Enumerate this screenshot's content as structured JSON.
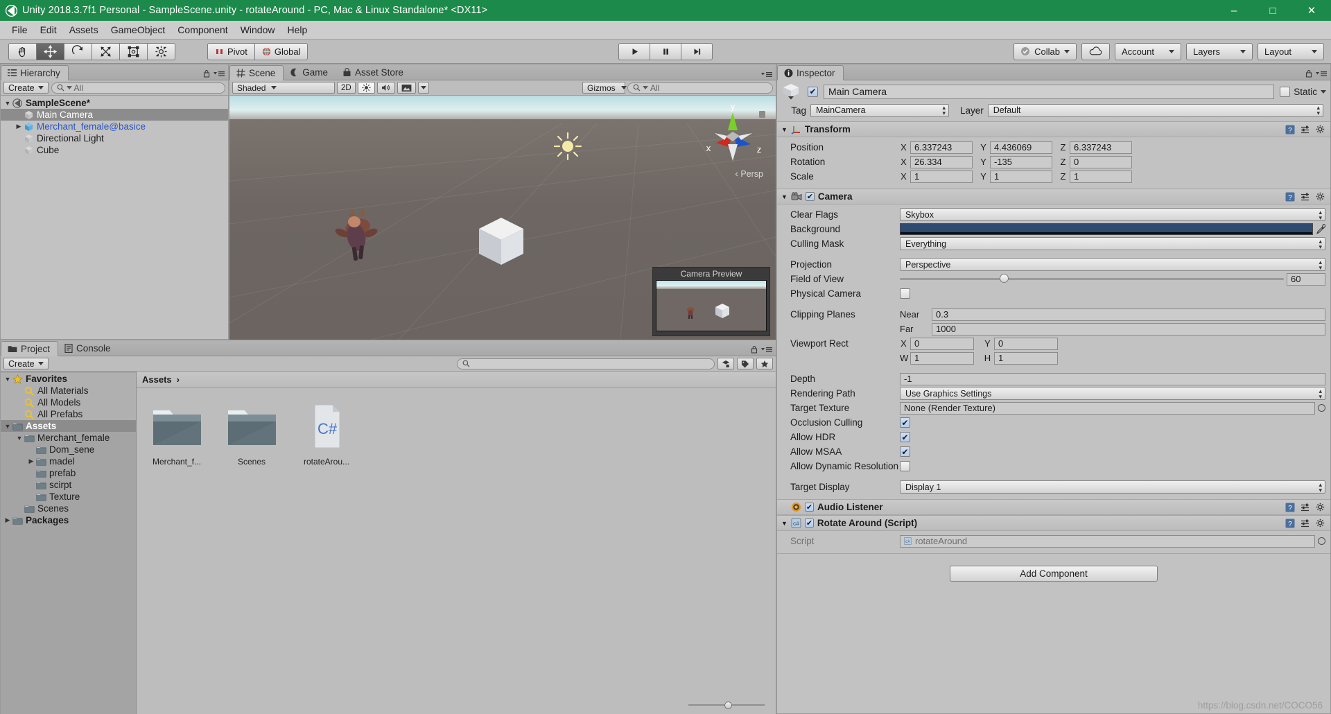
{
  "window": {
    "title": "Unity 2018.3.7f1 Personal - SampleScene.unity - rotateAround - PC, Mac & Linux Standalone* <DX11>",
    "minimize": "–",
    "maximize": "□",
    "close": "✕"
  },
  "menu": {
    "items": [
      "File",
      "Edit",
      "Assets",
      "GameObject",
      "Component",
      "Window",
      "Help"
    ]
  },
  "toolbar": {
    "tools": [
      {
        "name": "hand-tool",
        "active": false
      },
      {
        "name": "move-tool",
        "active": true
      },
      {
        "name": "rotate-tool",
        "active": false
      },
      {
        "name": "scale-tool",
        "active": false
      },
      {
        "name": "rect-tool",
        "active": false
      },
      {
        "name": "transform-tool",
        "active": false
      }
    ],
    "pivot_label": "Pivot",
    "global_label": "Global",
    "play_label": "▶",
    "pause_label": "❚❚",
    "step_label": "▶❘",
    "collab_label": "Collab",
    "account_label": "Account",
    "layers_label": "Layers",
    "layout_label": "Layout"
  },
  "hierarchy": {
    "tab": "Hierarchy",
    "create_label": "Create",
    "search_placeholder": "All",
    "items": [
      {
        "label": "SampleScene*",
        "indent": 0,
        "arrow": "▼",
        "icon": "scene-icon",
        "style": "bold",
        "selected": false
      },
      {
        "label": "Main Camera",
        "indent": 1,
        "arrow": "",
        "icon": "gameobject-icon",
        "style": "normal",
        "selected": true
      },
      {
        "label": "Merchant_female@basice",
        "indent": 1,
        "arrow": "▶",
        "icon": "prefab-icon",
        "style": "blue",
        "selected": false
      },
      {
        "label": "Directional Light",
        "indent": 1,
        "arrow": "",
        "icon": "gameobject-icon",
        "style": "normal",
        "selected": false
      },
      {
        "label": "Cube",
        "indent": 1,
        "arrow": "",
        "icon": "gameobject-icon",
        "style": "normal",
        "selected": false
      }
    ]
  },
  "scene": {
    "tabs": [
      {
        "label": "Scene",
        "icon": "scene-grid-icon",
        "active": true
      },
      {
        "label": "Game",
        "icon": "game-icon",
        "active": false
      },
      {
        "label": "Asset Store",
        "icon": "store-icon",
        "active": false
      }
    ],
    "shading_mode": "Shaded",
    "mode_2d": "2D",
    "gizmos_label": "Gizmos",
    "search_placeholder": "All",
    "axis_x": "x",
    "axis_y": "y",
    "axis_z": "z",
    "persp_label": "Persp",
    "camera_preview_title": "Camera Preview"
  },
  "project": {
    "tabs": [
      {
        "label": "Project",
        "icon": "folder-icon",
        "active": true
      },
      {
        "label": "Console",
        "icon": "console-icon",
        "active": false
      }
    ],
    "create_label": "Create",
    "search_placeholder": "",
    "breadcrumb": "Assets",
    "breadcrumb_sep": "›",
    "tree": [
      {
        "label": "Favorites",
        "indent": 0,
        "arrow": "▼",
        "icon": "star-icon",
        "style": "bold",
        "selected": false
      },
      {
        "label": "All Materials",
        "indent": 1,
        "arrow": "",
        "icon": "search-icon",
        "style": "normal",
        "selected": false
      },
      {
        "label": "All Models",
        "indent": 1,
        "arrow": "",
        "icon": "search-icon",
        "style": "normal",
        "selected": false
      },
      {
        "label": "All Prefabs",
        "indent": 1,
        "arrow": "",
        "icon": "search-icon",
        "style": "normal",
        "selected": false
      },
      {
        "label": "Assets",
        "indent": 0,
        "arrow": "▼",
        "icon": "folder-icon",
        "style": "bold",
        "selected": true
      },
      {
        "label": "Merchant_female",
        "indent": 1,
        "arrow": "▼",
        "icon": "folder-icon",
        "style": "normal",
        "selected": false
      },
      {
        "label": "Dom_sene",
        "indent": 2,
        "arrow": "",
        "icon": "folder-icon",
        "style": "normal",
        "selected": false
      },
      {
        "label": "madel",
        "indent": 2,
        "arrow": "▶",
        "icon": "folder-icon",
        "style": "normal",
        "selected": false
      },
      {
        "label": "prefab",
        "indent": 2,
        "arrow": "",
        "icon": "folder-icon",
        "style": "normal",
        "selected": false
      },
      {
        "label": "scirpt",
        "indent": 2,
        "arrow": "",
        "icon": "folder-icon",
        "style": "normal",
        "selected": false
      },
      {
        "label": "Texture",
        "indent": 2,
        "arrow": "",
        "icon": "folder-icon",
        "style": "normal",
        "selected": false
      },
      {
        "label": "Scenes",
        "indent": 1,
        "arrow": "",
        "icon": "folder-icon",
        "style": "normal",
        "selected": false
      },
      {
        "label": "Packages",
        "indent": 0,
        "arrow": "▶",
        "icon": "folder-icon",
        "style": "bold",
        "selected": false
      }
    ],
    "assets": [
      {
        "label": "Merchant_f...",
        "type": "folder"
      },
      {
        "label": "Scenes",
        "type": "folder"
      },
      {
        "label": "rotateArou...",
        "type": "csharp",
        "badge": "C#"
      }
    ]
  },
  "inspector": {
    "tab": "Inspector",
    "object_name": "Main Camera",
    "enabled": true,
    "static_label": "Static",
    "tag_label": "Tag",
    "tag_value": "MainCamera",
    "layer_label": "Layer",
    "layer_value": "Default",
    "transform": {
      "title": "Transform",
      "enabled": null,
      "rows": [
        {
          "label": "Position",
          "x": "6.337243",
          "y": "4.436069",
          "z": "6.337243"
        },
        {
          "label": "Rotation",
          "x": "26.334",
          "y": "-135",
          "z": "0"
        },
        {
          "label": "Scale",
          "x": "1",
          "y": "1",
          "z": "1"
        }
      ],
      "axis_labels": [
        "X",
        "Y",
        "Z"
      ]
    },
    "camera": {
      "title": "Camera",
      "enabled": true,
      "clear_flags_label": "Clear Flags",
      "clear_flags_value": "Skybox",
      "background_label": "Background",
      "background_color": "#2f4a6f",
      "culling_mask_label": "Culling Mask",
      "culling_mask_value": "Everything",
      "projection_label": "Projection",
      "projection_value": "Perspective",
      "fov_label": "Field of View",
      "fov_value": "60",
      "fov_percent": 27,
      "physical_camera_label": "Physical Camera",
      "physical_camera_checked": false,
      "clipping_label": "Clipping Planes",
      "near_label": "Near",
      "near_value": "0.3",
      "far_label": "Far",
      "far_value": "1000",
      "viewport_label": "Viewport Rect",
      "viewport_x_label": "X",
      "viewport_x": "0",
      "viewport_y_label": "Y",
      "viewport_y": "0",
      "viewport_w_label": "W",
      "viewport_w": "1",
      "viewport_h_label": "H",
      "viewport_h": "1",
      "depth_label": "Depth",
      "depth_value": "-1",
      "rendering_path_label": "Rendering Path",
      "rendering_path_value": "Use Graphics Settings",
      "target_texture_label": "Target Texture",
      "target_texture_value": "None (Render Texture)",
      "occlusion_label": "Occlusion Culling",
      "occlusion_checked": true,
      "hdr_label": "Allow HDR",
      "hdr_checked": true,
      "msaa_label": "Allow MSAA",
      "msaa_checked": true,
      "dynres_label": "Allow Dynamic Resolution",
      "dynres_checked": false,
      "target_display_label": "Target Display",
      "target_display_value": "Display 1"
    },
    "audio_listener": {
      "title": "Audio Listener",
      "enabled": true
    },
    "script_component": {
      "title": "Rotate Around (Script)",
      "enabled": true,
      "script_label": "Script",
      "script_value": "rotateAround"
    },
    "add_component_label": "Add Component"
  },
  "watermark": "https://blog.csdn.net/COCO56"
}
